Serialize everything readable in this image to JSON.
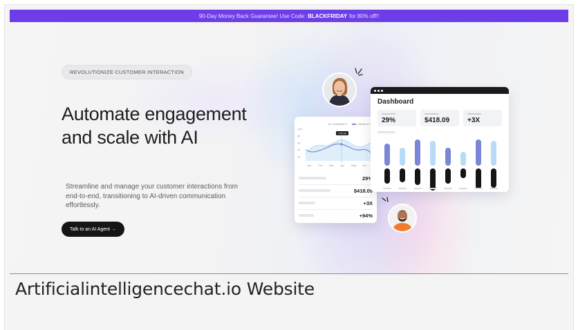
{
  "promo": {
    "text_before": "90-Day Money Back Guarantee! Use Code:",
    "code": "BLACKFRIDAY",
    "text_after": "for 80% off!!",
    "background": "#6c3de8"
  },
  "hero": {
    "eyebrow": "REVOLUTIONIZE CUSTOMER INTERACTION",
    "headline": "Automate engagement and scale with AI",
    "subtext": "Streamline and manage your customer interactions from end-to-end, transitioning to AI-driven communication effortlessly.",
    "cta_label": "Talk to an AI Agent",
    "cta_arrow": "→"
  },
  "chart_card": {
    "legend": [
      "Indication 1",
      "Indication 2"
    ],
    "series_colors": [
      "#b9dcf3",
      "#7e86d8"
    ],
    "callout": "478.00",
    "x_ticks": [
      "Jan",
      "Feb",
      "Mar",
      "Apr",
      "May",
      "Jun"
    ],
    "y_ticks": [
      "100",
      "80",
      "60",
      "40",
      "20"
    ],
    "stats": [
      "29%",
      "$418.09",
      "+3X",
      "+94%"
    ]
  },
  "dashboard": {
    "title": "Dashboard",
    "kpis": [
      "29%",
      "$418.09",
      "+3X"
    ],
    "bars_colors": {
      "top_a": "#7b86d6",
      "top_b": "#b9dcf6",
      "bottom": "#151515"
    }
  },
  "caption": "Artificialintelligencechat.io Website"
}
